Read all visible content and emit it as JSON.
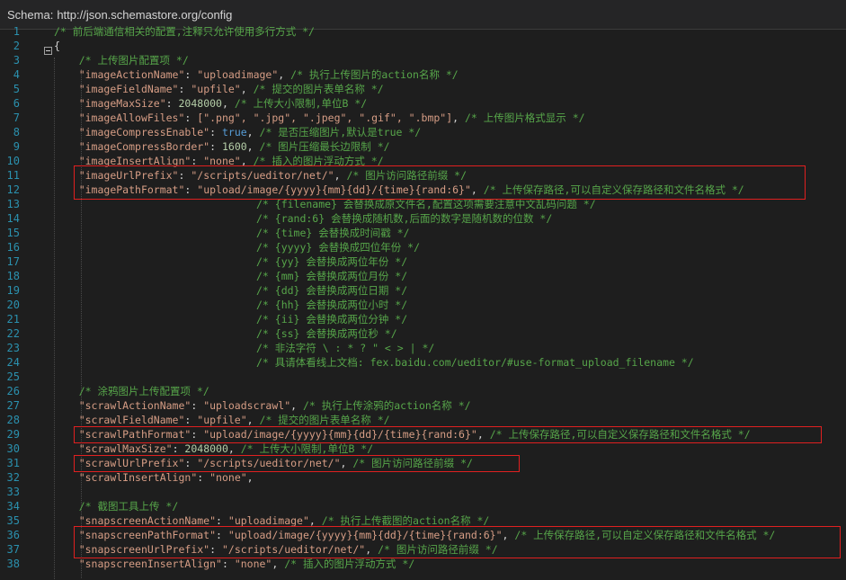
{
  "schema": {
    "label": "Schema:",
    "url": "http://json.schemastore.org/config"
  },
  "line_numbers": [
    "1",
    "2",
    "3",
    "4",
    "5",
    "6",
    "7",
    "8",
    "9",
    "10",
    "11",
    "12",
    "13",
    "14",
    "15",
    "16",
    "17",
    "18",
    "19",
    "20",
    "21",
    "22",
    "23",
    "24",
    "25",
    "26",
    "27",
    "28",
    "29",
    "30",
    "31",
    "32",
    "33",
    "34",
    "35",
    "36",
    "37",
    "38"
  ],
  "code": {
    "l1_comment": "/* 前后端通信相关的配置,注释只允许使用多行方式 */",
    "l2_brace": "{",
    "l3_comment": "/* 上传图片配置项 */",
    "l4": {
      "key": "\"imageActionName\"",
      "sep": ": ",
      "val": "\"uploadimage\"",
      "comma": ", ",
      "comment": "/* 执行上传图片的action名称 */"
    },
    "l5": {
      "key": "\"imageFieldName\"",
      "sep": ": ",
      "val": "\"upfile\"",
      "comma": ", ",
      "comment": "/* 提交的图片表单名称 */"
    },
    "l6": {
      "key": "\"imageMaxSize\"",
      "sep": ": ",
      "val": "2048000",
      "comma": ", ",
      "comment": "/* 上传大小限制,单位B */"
    },
    "l7": {
      "key": "\"imageAllowFiles\"",
      "sep": ": ",
      "val": "[\".png\", \".jpg\", \".jpeg\", \".gif\", \".bmp\"]",
      "comma": ", ",
      "comment": "/* 上传图片格式显示 */"
    },
    "l8": {
      "key": "\"imageCompressEnable\"",
      "sep": ": ",
      "val": "true",
      "comma": ", ",
      "comment": "/* 是否压缩图片,默认是true */"
    },
    "l9": {
      "key": "\"imageCompressBorder\"",
      "sep": ": ",
      "val": "1600",
      "comma": ", ",
      "comment": "/* 图片压缩最长边限制 */"
    },
    "l10": {
      "key": "\"imageInsertAlign\"",
      "sep": ": ",
      "val": "\"none\"",
      "comma": ", ",
      "comment": "/* 插入的图片浮动方式 */"
    },
    "l11": {
      "key": "\"imageUrlPrefix\"",
      "sep": ": ",
      "val": "\"/scripts/ueditor/net/\"",
      "comma": ", ",
      "comment": "/* 图片访问路径前缀 */"
    },
    "l12": {
      "key": "\"imagePathFormat\"",
      "sep": ": ",
      "val": "\"upload/image/{yyyy}{mm}{dd}/{time}{rand:6}\"",
      "comma": ", ",
      "comment": "/* 上传保存路径,可以自定义保存路径和文件名格式 */"
    },
    "l13": "/* {filename} 会替换成原文件名,配置这项需要注意中文乱码问题 */",
    "l14": "/* {rand:6} 会替换成随机数,后面的数字是随机数的位数 */",
    "l15": "/* {time} 会替换成时间戳 */",
    "l16": "/* {yyyy} 会替换成四位年份 */",
    "l17": "/* {yy} 会替换成两位年份 */",
    "l18": "/* {mm} 会替换成两位月份 */",
    "l19": "/* {dd} 会替换成两位日期 */",
    "l20": "/* {hh} 会替换成两位小时 */",
    "l21": "/* {ii} 会替换成两位分钟 */",
    "l22": "/* {ss} 会替换成两位秒 */",
    "l23": "/* 非法字符 \\ : * ? \" < > | */",
    "l24": "/* 具请体看线上文档: fex.baidu.com/ueditor/#use-format_upload_filename */",
    "l26_comment": "/* 涂鸦图片上传配置项 */",
    "l27": {
      "key": "\"scrawlActionName\"",
      "sep": ": ",
      "val": "\"uploadscrawl\"",
      "comma": ", ",
      "comment": "/* 执行上传涂鸦的action名称 */"
    },
    "l28": {
      "key": "\"scrawlFieldName\"",
      "sep": ": ",
      "val": "\"upfile\"",
      "comma": ", ",
      "comment": "/* 提交的图片表单名称 */"
    },
    "l29": {
      "key": "\"scrawlPathFormat\"",
      "sep": ": ",
      "val": "\"upload/image/{yyyy}{mm}{dd}/{time}{rand:6}\"",
      "comma": ", ",
      "comment": "/* 上传保存路径,可以自定义保存路径和文件名格式 */"
    },
    "l30": {
      "key": "\"scrawlMaxSize\"",
      "sep": ": ",
      "val": "2048000",
      "comma": ", ",
      "comment": "/* 上传大小限制,单位B */"
    },
    "l31": {
      "key": "\"scrawlUrlPrefix\"",
      "sep": ": ",
      "val": "\"/scripts/ueditor/net/\"",
      "comma": ", ",
      "comment": "/* 图片访问路径前缀 */"
    },
    "l32": {
      "key": "\"scrawlInsertAlign\"",
      "sep": ": ",
      "val": "\"none\"",
      "comma": ",",
      "comment": ""
    },
    "l34_comment": "/* 截图工具上传 */",
    "l35": {
      "key": "\"snapscreenActionName\"",
      "sep": ": ",
      "val": "\"uploadimage\"",
      "comma": ", ",
      "comment": "/* 执行上传截图的action名称 */"
    },
    "l36": {
      "key": "\"snapscreenPathFormat\"",
      "sep": ": ",
      "val": "\"upload/image/{yyyy}{mm}{dd}/{time}{rand:6}\"",
      "comma": ", ",
      "comment": "/* 上传保存路径,可以自定义保存路径和文件名格式 */"
    },
    "l37": {
      "key": "\"snapscreenUrlPrefix\"",
      "sep": ": ",
      "val": "\"/scripts/ueditor/net/\"",
      "comma": ", ",
      "comment": "/* 图片访问路径前缀 */"
    },
    "l38": {
      "key": "\"snapscreenInsertAlign\"",
      "sep": ": ",
      "val": "\"none\"",
      "comma": ", ",
      "comment": "/* 插入的图片浮动方式 */"
    }
  },
  "highlight_color": "#e02020",
  "colors": {
    "comment": "#57a64a",
    "string": "#d69d85",
    "number": "#b5cea8",
    "keyword": "#569cd6",
    "line_number": "#2b91af"
  }
}
